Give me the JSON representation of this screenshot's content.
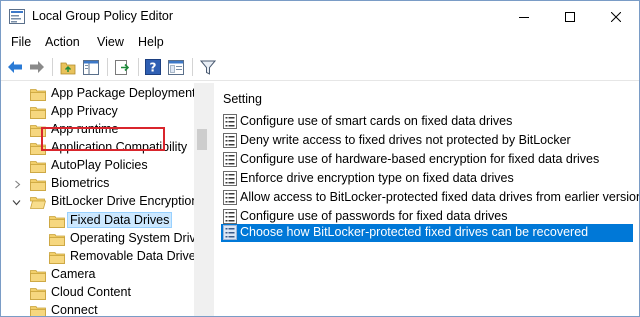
{
  "window": {
    "title": "Local Group Policy Editor",
    "accent": "#0078d7",
    "highlight_color": "#d9252c"
  },
  "menu": {
    "items": [
      "File",
      "Action",
      "View",
      "Help"
    ]
  },
  "toolbar": {
    "buttons": [
      "back-arrow-icon",
      "forward-arrow-icon",
      "up-folder-icon",
      "show-hide-tree-icon",
      "export-list-icon",
      "help-icon",
      "properties-icon",
      "filter-icon"
    ]
  },
  "tree": {
    "items": [
      {
        "label": "App Package Deployment",
        "expandable": false
      },
      {
        "label": "App Privacy",
        "expandable": false
      },
      {
        "label": "App runtime",
        "expandable": false
      },
      {
        "label": "Application Compatibility",
        "expandable": false
      },
      {
        "label": "AutoPlay Policies",
        "expandable": false
      },
      {
        "label": "Biometrics",
        "expandable": true,
        "expanded": false
      },
      {
        "label": "BitLocker Drive Encryption",
        "expandable": true,
        "expanded": true
      },
      {
        "label": "Fixed Data Drives",
        "expandable": false,
        "selected": true
      },
      {
        "label": "Operating System Drive",
        "expandable": false
      },
      {
        "label": "Removable Data Drives",
        "expandable": false
      },
      {
        "label": "Camera",
        "expandable": false
      },
      {
        "label": "Cloud Content",
        "expandable": false
      },
      {
        "label": "Connect",
        "expandable": false
      }
    ]
  },
  "settings": {
    "header": "Setting",
    "rows": [
      {
        "label": "Configure use of smart cards on fixed data drives"
      },
      {
        "label": "Deny write access to fixed drives not protected by BitLocker"
      },
      {
        "label": "Configure use of hardware-based encryption for fixed data drives"
      },
      {
        "label": "Enforce drive encryption type on fixed data drives"
      },
      {
        "label": "Allow access to BitLocker-protected fixed data drives from earlier versions o"
      },
      {
        "label": "Configure use of passwords for fixed data drives"
      },
      {
        "label": "Choose how BitLocker-protected fixed drives can be recovered",
        "selected": true
      }
    ]
  }
}
